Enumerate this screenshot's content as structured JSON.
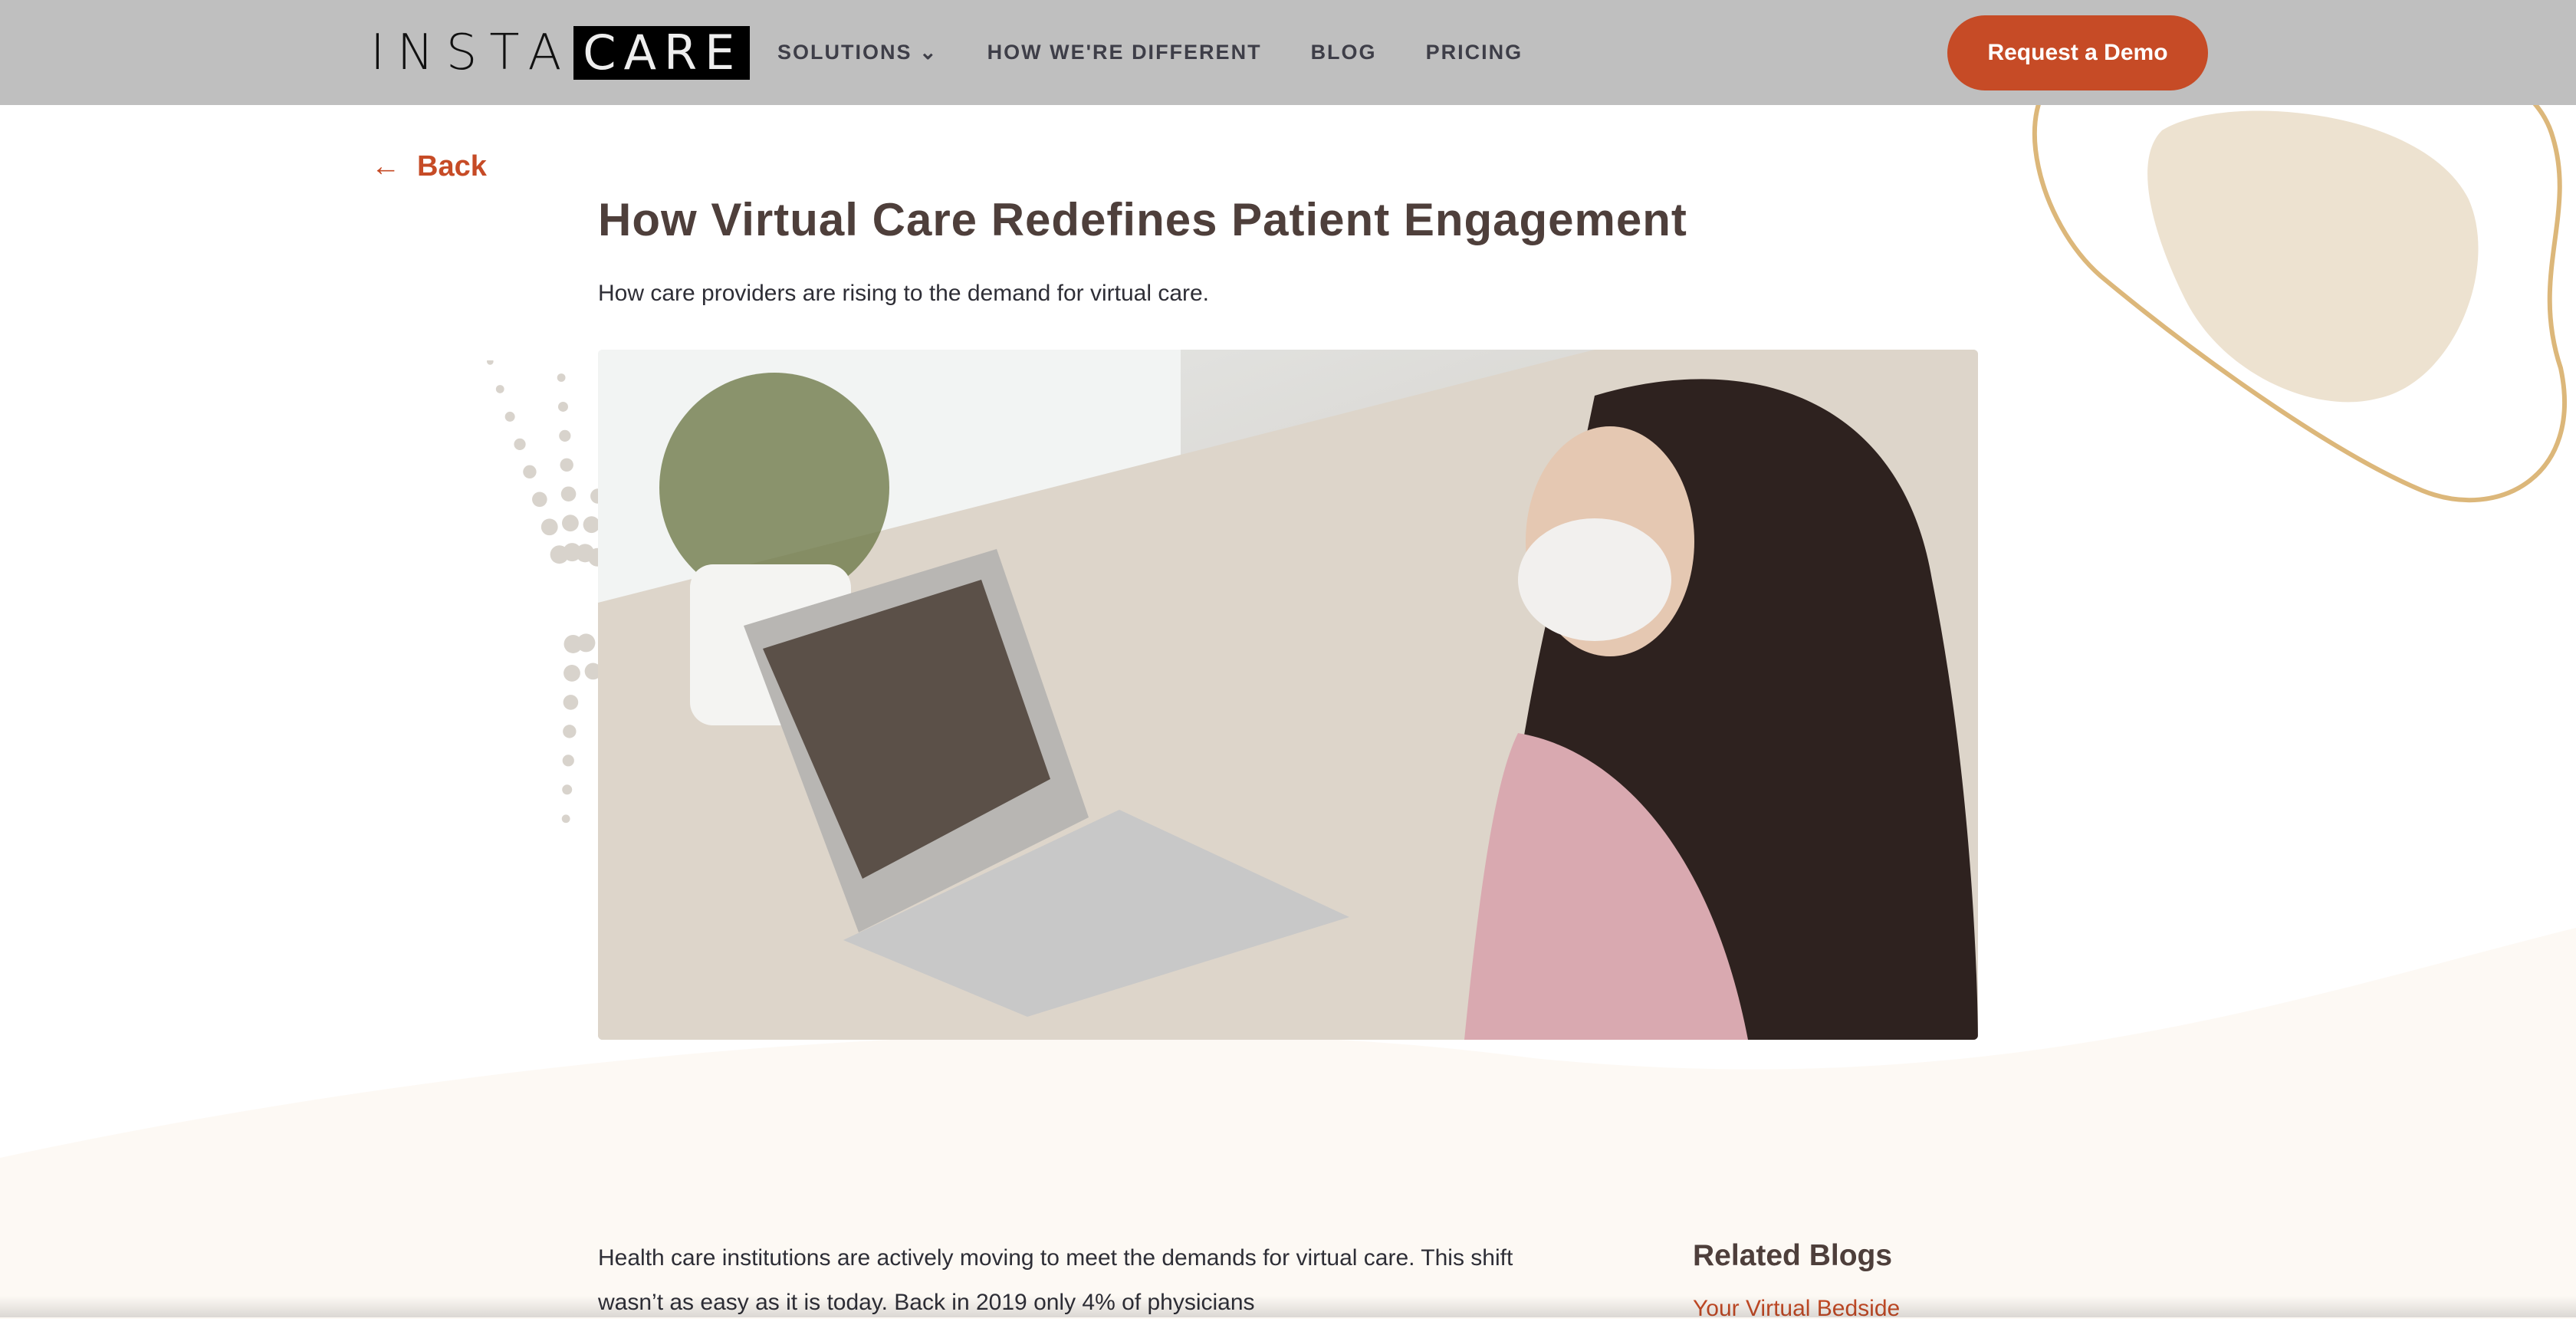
{
  "nav": {
    "logo_left": "INSTA",
    "logo_right": "CARE",
    "items": [
      "SOLUTIONS",
      "HOW WE'RE DIFFERENT",
      "BLOG",
      "PRICING"
    ],
    "cta": "Request a Demo"
  },
  "article": {
    "back": "Back",
    "title": "How Virtual Care Redefines Patient Engagement",
    "subtitle": "How care providers are rising to the demand for virtual care.",
    "body": "Health care institutions are actively moving to meet the demands for virtual care. This shift wasn’t as easy as it is today. Back in 2019 only 4% of physicians"
  },
  "sidebar": {
    "heading": "Related Blogs",
    "links": [
      "Your Virtual Bedside"
    ]
  },
  "colors": {
    "accent": "#c64b26",
    "nav_bg": "#bfbfbf",
    "cream": "#fdf9f4",
    "blob": "#ede2d0"
  }
}
